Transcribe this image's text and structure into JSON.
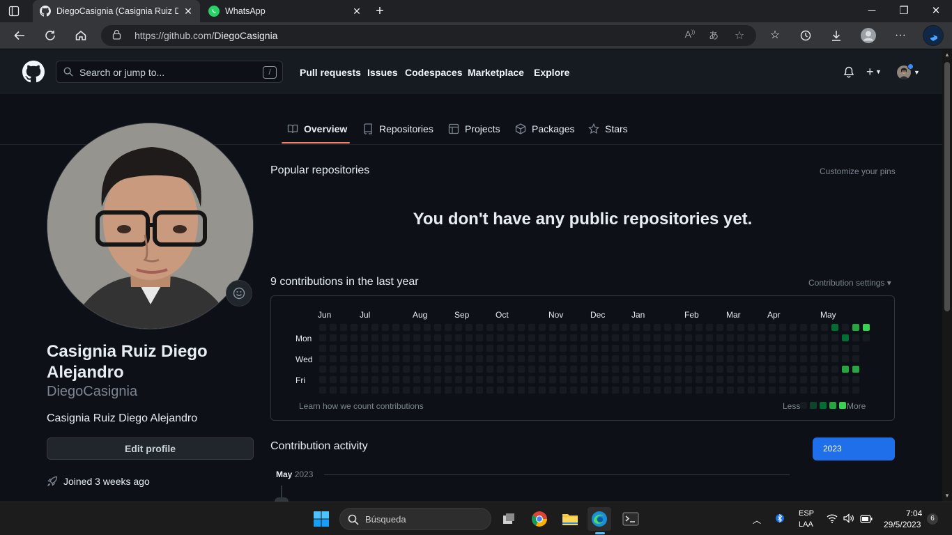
{
  "browser": {
    "tabs": [
      {
        "title": "DiegoCasignia (Casignia Ruiz Die",
        "active": true
      },
      {
        "title": "WhatsApp",
        "active": false
      }
    ],
    "url_host": "https://github.com/",
    "url_path": "DiegoCasignia"
  },
  "github": {
    "search_placeholder": "Search or jump to...",
    "search_key": "/",
    "nav": [
      "Pull requests",
      "Issues",
      "Codespaces",
      "Marketplace",
      "Explore"
    ],
    "profile_tabs": [
      "Overview",
      "Repositories",
      "Projects",
      "Packages",
      "Stars"
    ],
    "active_tab": "Overview"
  },
  "profile": {
    "full_name": "Casignia Ruiz Diego Alejandro",
    "username": "DiegoCasignia",
    "bio": "Casignia Ruiz Diego Alejandro",
    "edit_button": "Edit profile",
    "joined": "Joined 3 weeks ago"
  },
  "main": {
    "popular_title": "Popular repositories",
    "customize_pins": "Customize your pins",
    "empty_message": "You don't have any public repositories yet.",
    "contrib_title": "9 contributions in the last year",
    "contrib_settings": "Contribution settings ▾",
    "months": [
      "Jun",
      "Jul",
      "Aug",
      "Sep",
      "Oct",
      "Nov",
      "Dec",
      "Jan",
      "Feb",
      "Mar",
      "Apr",
      "May"
    ],
    "days": [
      "Mon",
      "Wed",
      "Fri"
    ],
    "learn_link": "Learn how we count contributions",
    "legend_less": "Less",
    "legend_more": "More",
    "activity_title": "Contribution activity",
    "year_button": "2023",
    "activity_month": "May",
    "activity_year": "2023",
    "contributions": [
      {
        "week": 49,
        "day": 0,
        "level": 2
      },
      {
        "week": 50,
        "day": 1,
        "level": 2
      },
      {
        "week": 51,
        "day": 0,
        "level": 3
      },
      {
        "week": 52,
        "day": 0,
        "level": 4
      },
      {
        "week": 50,
        "day": 4,
        "level": 3
      },
      {
        "week": 51,
        "day": 4,
        "level": 3
      }
    ],
    "colors": {
      "empty": "#161b22",
      "l1": "#0e4429",
      "l2": "#006d32",
      "l3": "#26a641",
      "l4": "#39d353"
    }
  },
  "taskbar": {
    "search": "Búsqueda",
    "lang1": "ESP",
    "lang2": "LAA",
    "time": "7:04",
    "date": "29/5/2023",
    "notifications": "6"
  }
}
